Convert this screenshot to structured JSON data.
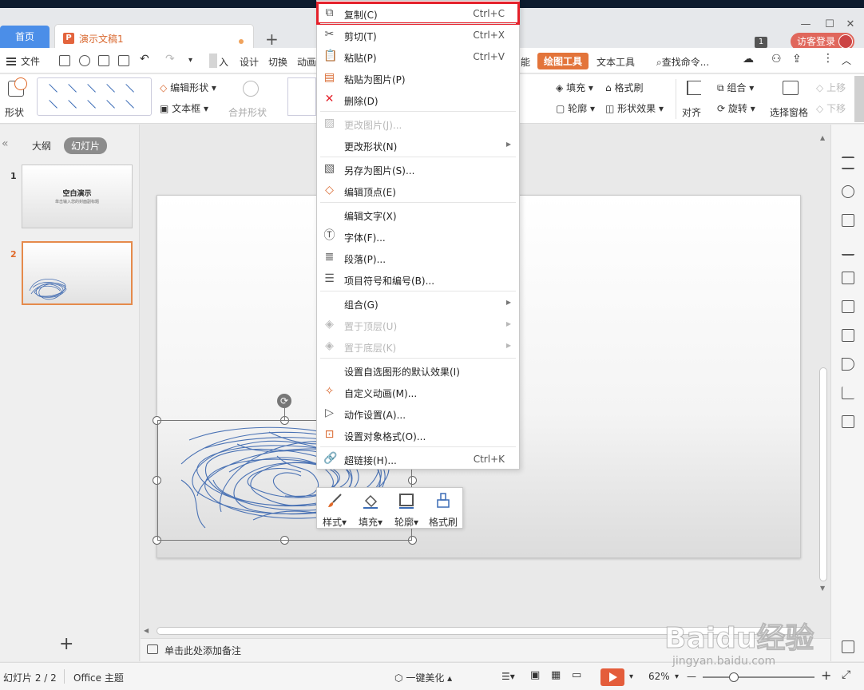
{
  "tabs": {
    "home": "首页",
    "document": "演示文稿1",
    "add": "+"
  },
  "header": {
    "badge": "1",
    "login": "访客登录"
  },
  "menubar": {
    "file": "文件",
    "items": [
      "入",
      "设计",
      "切换",
      "动画",
      "能",
      "绘图工具",
      "文本工具",
      "查找命令..."
    ]
  },
  "ribbon": {
    "shape": "形状",
    "edit_shape": "编辑形状",
    "text_box": "文本框",
    "merge_shape": "合并形状",
    "fill": "填充",
    "outline": "轮廓",
    "format_painter": "格式刷",
    "shape_effects": "形状效果",
    "align": "对齐",
    "group": "组合",
    "rotate": "旋转",
    "selection_pane": "选择窗格",
    "bring_forward": "上移",
    "send_backward": "下移"
  },
  "left_panel": {
    "outline_tab": "大纲",
    "slides_tab": "幻灯片",
    "slides": [
      {
        "num": "1",
        "title": "空白演示",
        "subtitle": "单击输入您的封面副标题"
      },
      {
        "num": "2"
      }
    ],
    "add_slide": "+"
  },
  "context_menu": [
    {
      "label": "复制(C)",
      "shortcut": "Ctrl+C",
      "icon": "copy-icon",
      "enabled": true,
      "highlighted": true
    },
    {
      "label": "剪切(T)",
      "shortcut": "Ctrl+X",
      "icon": "cut-icon",
      "enabled": true
    },
    {
      "label": "粘贴(P)",
      "shortcut": "Ctrl+V",
      "icon": "paste-icon",
      "enabled": true
    },
    {
      "label": "粘贴为图片(P)",
      "icon": "paste-image-icon",
      "enabled": true
    },
    {
      "label": "删除(D)",
      "icon": "delete-icon",
      "enabled": true
    },
    {
      "label": "更改图片(J)...",
      "icon": "change-image-icon",
      "enabled": false
    },
    {
      "label": "更改形状(N)",
      "submenu": true,
      "enabled": true
    },
    {
      "label": "另存为图片(S)...",
      "icon": "save-image-icon",
      "enabled": true
    },
    {
      "label": "编辑顶点(E)",
      "icon": "edit-points-icon",
      "enabled": true
    },
    {
      "label": "编辑文字(X)",
      "enabled": true
    },
    {
      "label": "字体(F)...",
      "icon": "font-icon",
      "enabled": true
    },
    {
      "label": "段落(P)...",
      "icon": "paragraph-icon",
      "enabled": true
    },
    {
      "label": "项目符号和编号(B)...",
      "icon": "bullets-icon",
      "enabled": true
    },
    {
      "label": "组合(G)",
      "submenu": true,
      "enabled": true
    },
    {
      "label": "置于顶层(U)",
      "icon": "bring-front-icon",
      "submenu": true,
      "enabled": false
    },
    {
      "label": "置于底层(K)",
      "icon": "send-back-icon",
      "submenu": true,
      "enabled": false
    },
    {
      "label": "设置自选图形的默认效果(I)",
      "enabled": true
    },
    {
      "label": "自定义动画(M)...",
      "icon": "animation-icon",
      "enabled": true
    },
    {
      "label": "动作设置(A)...",
      "icon": "action-icon",
      "enabled": true
    },
    {
      "label": "设置对象格式(O)...",
      "icon": "format-object-icon",
      "enabled": true
    },
    {
      "label": "超链接(H)...",
      "shortcut": "Ctrl+K",
      "icon": "hyperlink-icon",
      "enabled": true
    }
  ],
  "mini_toolbar": [
    {
      "label": "样式",
      "icon": "brush-icon"
    },
    {
      "label": "填充",
      "icon": "fill-bucket-icon"
    },
    {
      "label": "轮廓",
      "icon": "outline-icon"
    },
    {
      "label": "格式刷",
      "icon": "format-painter-icon"
    }
  ],
  "notes": {
    "placeholder": "单击此处添加备注"
  },
  "statusbar": {
    "slide_position": "幻灯片 2 / 2",
    "theme": "Office 主题",
    "beautify": "一键美化",
    "zoom": "62%",
    "minus": "—",
    "plus": "+"
  },
  "watermark": {
    "brand": "Baidu经验",
    "url": "jingyan.baidu.com"
  },
  "colors": {
    "accent_orange": "#e3743a",
    "highlight_red": "#e4202a",
    "tab_blue": "#4b8ee8",
    "scribble_blue": "#4a72b4"
  }
}
